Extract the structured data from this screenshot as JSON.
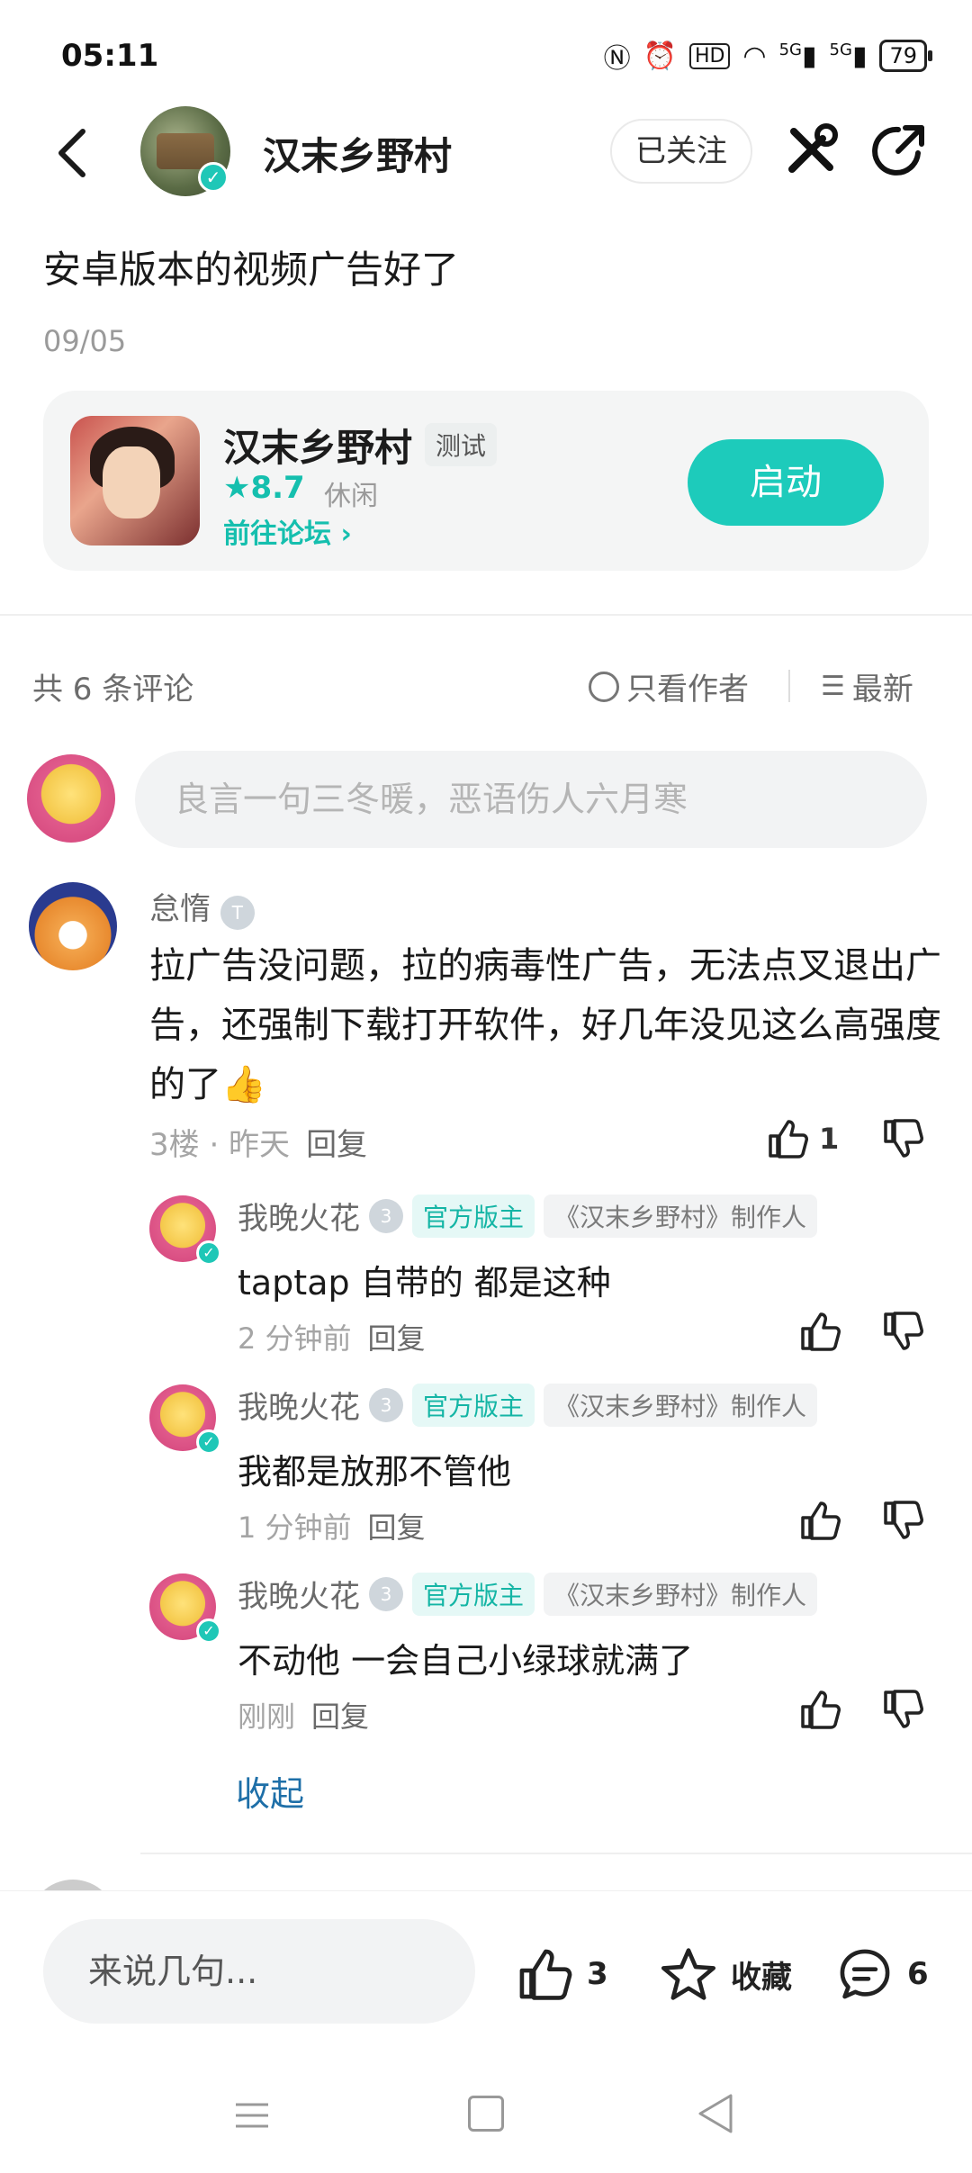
{
  "status_bar": {
    "time": "05:11",
    "network": "5G",
    "battery": "79"
  },
  "header": {
    "title": "汉末乡野村",
    "follow_label": "已关注"
  },
  "post": {
    "title": "安卓版本的视频广告好了",
    "date": "09/05"
  },
  "game_card": {
    "name": "汉末乡野村",
    "tag": "测试",
    "rating": "8.7",
    "genre": "休闲",
    "forum_link": "前往论坛",
    "launch_label": "启动"
  },
  "comments_header": {
    "count": "共 6 条评论",
    "author_only": "只看作者",
    "sort": "最新"
  },
  "comment_input": {
    "placeholder": "良言一句三冬暖，恶语伤人六月寒"
  },
  "comment": {
    "user": "怠惰",
    "text": "拉广告没问题，拉的病毒性广告，无法点叉退出广告，还强制下载打开软件，好几年没见这么高强度的了👍",
    "meta": "3楼 · 昨天",
    "reply_label": "回复",
    "likes": "1"
  },
  "replies": [
    {
      "user": "我晚火花",
      "level": "3",
      "tag_mod": "官方版主",
      "tag_maker": "《汉末乡野村》制作人",
      "text": "taptap 自带的 都是这种",
      "time": "2 分钟前",
      "reply_label": "回复"
    },
    {
      "user": "我晚火花",
      "level": "3",
      "tag_mod": "官方版主",
      "tag_maker": "《汉末乡野村》制作人",
      "text": "我都是放那不管他",
      "time": "1 分钟前",
      "reply_label": "回复"
    },
    {
      "user": "我晚火花",
      "level": "3",
      "tag_mod": "官方版主",
      "tag_maker": "《汉末乡野村》制作人",
      "text": "不动他 一会自己小绿球就满了",
      "time": "刚刚",
      "reply_label": "回复"
    }
  ],
  "collapse_label": "收起",
  "bottom_bar": {
    "input_placeholder": "来说几句...",
    "likes": "3",
    "favorite_label": "收藏",
    "comments": "6"
  },
  "colors": {
    "accent": "#1dcbbb",
    "link": "#1e6fa8",
    "muted": "#a5a5a5"
  }
}
